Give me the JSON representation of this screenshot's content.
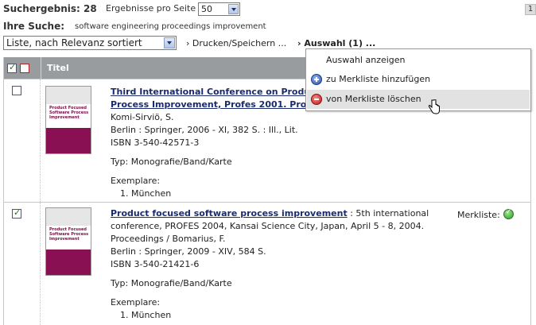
{
  "header": {
    "hits_label": "Suchergebnis:",
    "hits_count": "28",
    "per_page_label": "Ergebnisse pro Seite",
    "per_page_value": "50",
    "page_number": "1",
    "search_label": "Ihre Suche:",
    "search_value": "software engineering proceedings improvement",
    "sort_value": "Liste, nach Relevanz sortiert",
    "print_link": "› Drucken/Speichern ...",
    "selection_link": "› Auswahl (1) ..."
  },
  "table": {
    "title_header": "Titel"
  },
  "results": [
    {
      "checked": false,
      "cover_text": "Product Focused Software Process Improvement",
      "lines": [
        "Komi-Sirviö, S.",
        "Berlin : Springer, 2006 - XI, 382 S. : Ill., Lit.",
        "ISBN 3-540-42571-3"
      ],
      "title_line1": "Third International Conference on Produ",
      "title_line2": "Process Improvement, Profes 2001. Pro",
      "type": "Typ: Monografie/Band/Karte",
      "copies_label": "Exemplare:",
      "copies": [
        "1.  München"
      ]
    },
    {
      "checked": true,
      "cover_text": "Product Focused Software Process Improvement",
      "title": "Product focused software process improvement",
      "title_rest": " : 5th international",
      "lines": [
        "conference, PROFES 2004, Kansai Science City, Japan, April 5 - 8, 2004.",
        "Proceedings / Bomarius, F.",
        "Berlin : Springer, 2009 - XIV, 584 S.",
        "ISBN 3-540-21421-6"
      ],
      "merkliste_label": "Merkliste:",
      "type": "Typ: Monografie/Band/Karte",
      "copies_label": "Exemplare:",
      "copies": [
        "1.  München"
      ]
    }
  ],
  "menu": {
    "items": [
      {
        "label": "Auswahl anzeigen",
        "icon": "none"
      },
      {
        "label": "zu Merkliste hinzufügen",
        "icon": "plus-circle-icon"
      },
      {
        "label": "von Merkliste löschen",
        "icon": "minus-circle-icon",
        "highlighted": true
      }
    ]
  },
  "colors": {
    "header_bg": "#999c9f",
    "title_link": "#1a2b6e",
    "cover": "#8a1054",
    "menu_highlight": "#e2e2e2"
  }
}
